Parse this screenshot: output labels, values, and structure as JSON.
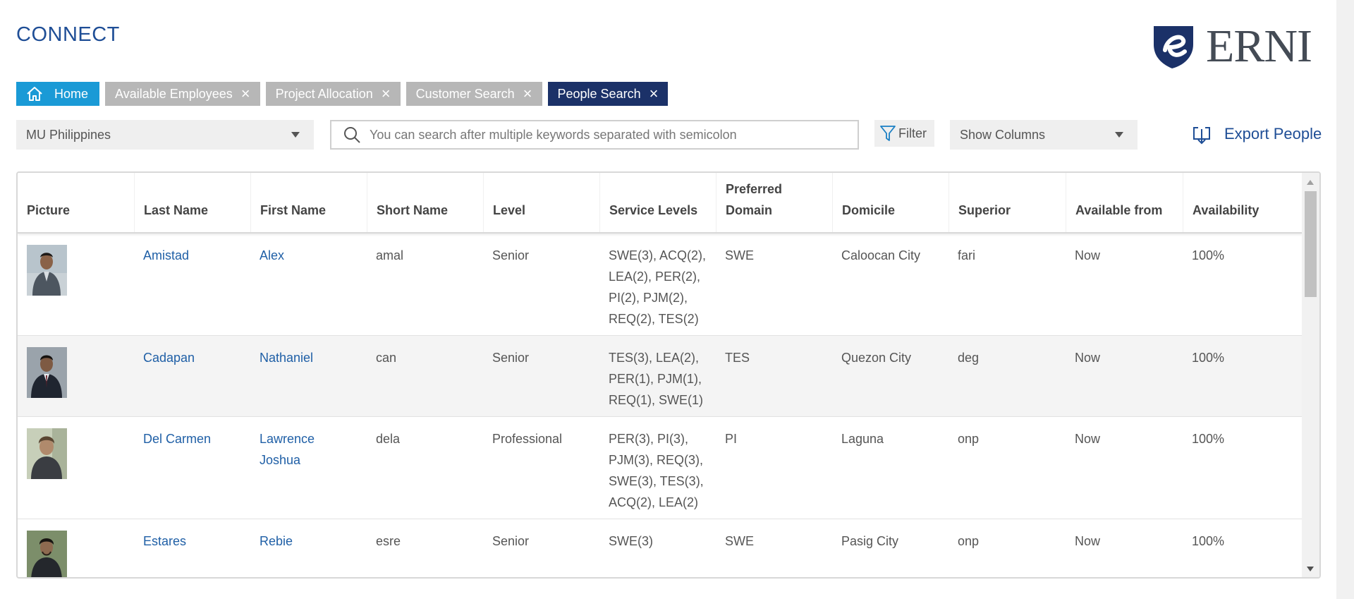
{
  "app": {
    "title": "CONNECT",
    "logo_text": "ERNI"
  },
  "tabs": [
    {
      "label": "Home"
    },
    {
      "label": "Available Employees"
    },
    {
      "label": "Project Allocation"
    },
    {
      "label": "Customer Search"
    },
    {
      "label": "People Search"
    }
  ],
  "toolbar": {
    "unit_value": "MU Philippines",
    "search_placeholder": "You can search after multiple keywords separated with semicolon",
    "filter_label": "Filter",
    "columns_label": "Show Columns",
    "export_label": "Export People"
  },
  "table": {
    "headers": [
      "Picture",
      "Last Name",
      "First Name",
      "Short Name",
      "Level",
      "Service Levels",
      "Preferred Domain",
      "Domicile",
      "Superior",
      "Available from",
      "Availability"
    ],
    "rows": [
      {
        "last": "Amistad",
        "first": "Alex",
        "short": "amal",
        "level": "Senior",
        "service": "SWE(3), ACQ(2), LEA(2), PER(2), PI(2), PJM(2), REQ(2), TES(2)",
        "domain": "SWE",
        "domicile": "Caloocan City",
        "superior": "fari",
        "from": "Now",
        "availability": "100%"
      },
      {
        "last": "Cadapan",
        "first": "Nathaniel",
        "short": "can",
        "level": "Senior",
        "service": "TES(3), LEA(2), PER(1), PJM(1), REQ(1), SWE(1)",
        "domain": "TES",
        "domicile": "Quezon City",
        "superior": "deg",
        "from": "Now",
        "availability": "100%"
      },
      {
        "last": "Del Carmen",
        "first": "Lawrence Joshua",
        "short": "dela",
        "level": "Professional",
        "service": "PER(3), PI(3), PJM(3), REQ(3), SWE(3), TES(3), ACQ(2), LEA(2)",
        "domain": "PI",
        "domicile": "Laguna",
        "superior": "onp",
        "from": "Now",
        "availability": "100%"
      },
      {
        "last": "Estares",
        "first": "Rebie",
        "short": "esre",
        "level": "Senior",
        "service": "SWE(3)",
        "domain": "SWE",
        "domicile": "Pasig City",
        "superior": "onp",
        "from": "Now",
        "availability": "100%"
      }
    ]
  },
  "colors": {
    "brand": "#1f4e96",
    "home_tab": "#1a9ad6",
    "active_tab": "#1b3168",
    "inactive_tab": "#b7b7b7"
  }
}
